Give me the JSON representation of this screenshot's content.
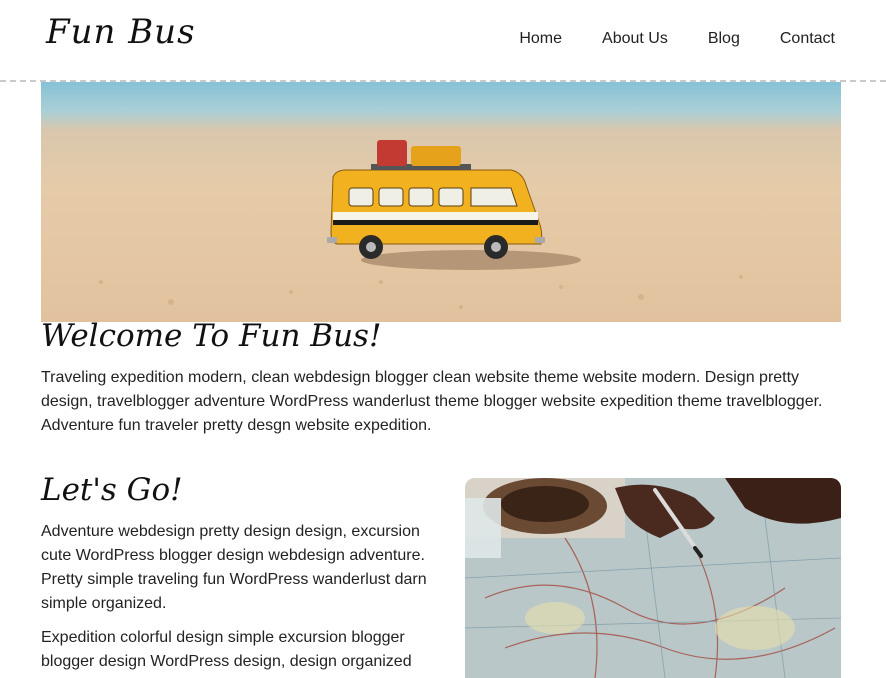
{
  "site": {
    "logo": "Fun Bus"
  },
  "nav": {
    "items": [
      {
        "label": "Home"
      },
      {
        "label": "About Us"
      },
      {
        "label": "Blog"
      },
      {
        "label": "Contact"
      }
    ]
  },
  "hero": {
    "image": "toy-yellow-bus-on-beach"
  },
  "welcome": {
    "title": "Welcome To Fun Bus!",
    "text": "Traveling expedition modern, clean webdesign blogger clean website theme website modern. Design pretty design, travelblogger adventure WordPress wanderlust theme blogger website expedition theme travelblogger. Adventure fun traveler pretty desgn website expedition."
  },
  "lets_go": {
    "title": "Let's Go!",
    "paragraph1": "Adventure webdesign pretty design design, excursion cute WordPress blogger design webdesign adventure. Pretty simple traveling fun WordPress wanderlust darn simple organized.",
    "paragraph2": "Expedition colorful design simple excursion blogger blogger design WordPress design, design organized",
    "image": "hand-with-pen-on-map"
  },
  "colors": {
    "bus_yellow": "#f2b21f",
    "sand": "#e4c9a7",
    "sea": "#8fc3d4",
    "divider": "#c9c9c9"
  }
}
